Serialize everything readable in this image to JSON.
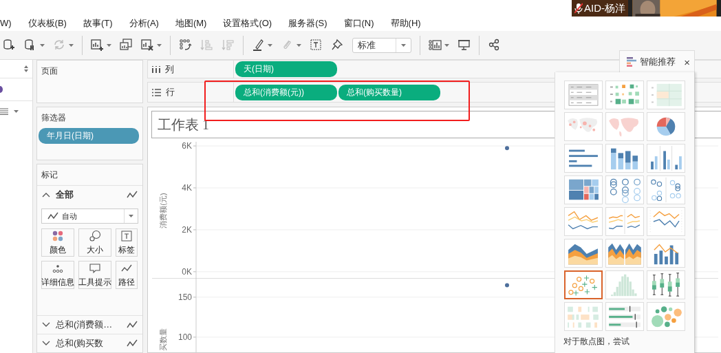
{
  "webcam": {
    "label": "AID-杨洋",
    "muted": true
  },
  "menu": [
    "W)",
    "仪表板(B)",
    "故事(T)",
    "分析(A)",
    "地图(M)",
    "设置格式(O)",
    "服务器(S)",
    "窗口(N)",
    "帮助(H)"
  ],
  "toolbar": {
    "groups": [
      [
        {
          "kind": "add-data",
          "disabled": false,
          "caret": false
        },
        {
          "kind": "pause",
          "disabled": false,
          "caret": true
        },
        {
          "kind": "refresh",
          "disabled": true,
          "caret": true
        }
      ],
      [
        {
          "kind": "new-sheet",
          "disabled": false,
          "caret": true
        },
        {
          "kind": "duplicate",
          "disabled": false,
          "caret": false
        },
        {
          "kind": "clear",
          "disabled": false,
          "caret": true
        }
      ],
      [
        {
          "kind": "swap",
          "disabled": false,
          "caret": false
        },
        {
          "kind": "sort-asc",
          "disabled": true,
          "caret": false
        },
        {
          "kind": "sort-desc",
          "disabled": true,
          "caret": false
        }
      ],
      [
        {
          "kind": "highlight",
          "disabled": false,
          "caret": true
        },
        {
          "kind": "group",
          "disabled": true,
          "caret": true
        },
        {
          "kind": "label",
          "disabled": false,
          "caret": false
        },
        {
          "kind": "pin",
          "disabled": false,
          "caret": false
        },
        {
          "kind": "dropdown",
          "value": "标准"
        }
      ],
      [
        {
          "kind": "show-cards",
          "disabled": false,
          "caret": true
        },
        {
          "kind": "present",
          "disabled": false,
          "caret": false
        }
      ],
      [
        {
          "kind": "share",
          "disabled": false,
          "caret": false
        }
      ]
    ]
  },
  "pages": {
    "title": "页面"
  },
  "filters": {
    "title": "筛选器",
    "pills": [
      "年月日(日期)"
    ]
  },
  "marks": {
    "title": "标记",
    "all": {
      "label": "全部",
      "expanded": true
    },
    "mark_type": "自动",
    "buttons": [
      {
        "label": "颜色",
        "kind": "color"
      },
      {
        "label": "大小",
        "kind": "size"
      },
      {
        "label": "标签",
        "kind": "label"
      },
      {
        "label": "详细信息",
        "kind": "detail"
      },
      {
        "label": "工具提示",
        "kind": "tooltip"
      },
      {
        "label": "路径",
        "kind": "path"
      }
    ],
    "measures": [
      {
        "label": "总和(消费额…",
        "expanded": false
      },
      {
        "label": "总和(购买数",
        "expanded": false
      }
    ]
  },
  "shelves": {
    "columns": {
      "label": "列",
      "pills": [
        "天(日期)"
      ]
    },
    "rows": {
      "label": "行",
      "pills": [
        "总和(消费额(元))",
        "总和(购买数量)"
      ]
    }
  },
  "view": {
    "title": "工作表 1",
    "panes": [
      {
        "chart_data": {
          "type": "scatter",
          "grid": true,
          "ylabel": "消费额(元)",
          "ylim": [
            -300,
            6200
          ],
          "yticks": [
            {
              "value": 0,
              "label": "0K"
            },
            {
              "value": 2000,
              "label": "2K"
            },
            {
              "value": 4000,
              "label": "4K"
            },
            {
              "value": 6000,
              "label": "6K"
            }
          ],
          "values": [
            5900
          ]
        }
      },
      {
        "chart_data": {
          "type": "scatter",
          "grid": true,
          "ylabel": "买数量",
          "ylim": [
            81,
            174
          ],
          "yticks": [
            {
              "value": 100,
              "label": "100"
            },
            {
              "value": 150,
              "label": "150"
            }
          ],
          "values": [
            165
          ]
        }
      }
    ]
  },
  "show_me": {
    "title": "智能推荐",
    "close": "×",
    "hint": "对于散点图，尝试",
    "thumbnails": [
      {
        "kind": "text-table",
        "selected": false
      },
      {
        "kind": "heat-map",
        "selected": false
      },
      {
        "kind": "highlight-table",
        "selected": false
      },
      {
        "kind": "symbol-map",
        "selected": false
      },
      {
        "kind": "filled-map",
        "selected": false
      },
      {
        "kind": "pie",
        "selected": false
      },
      {
        "kind": "hbar",
        "selected": false
      },
      {
        "kind": "stacked-bar",
        "selected": false
      },
      {
        "kind": "side-bar",
        "selected": false
      },
      {
        "kind": "treemap",
        "selected": false
      },
      {
        "kind": "circles",
        "selected": false
      },
      {
        "kind": "side-circles",
        "selected": false
      },
      {
        "kind": "lines",
        "selected": false
      },
      {
        "kind": "lines-split",
        "selected": false
      },
      {
        "kind": "dual-line",
        "selected": false
      },
      {
        "kind": "area",
        "selected": false
      },
      {
        "kind": "area-split",
        "selected": false
      },
      {
        "kind": "combo",
        "selected": false
      },
      {
        "kind": "scatter",
        "selected": true
      },
      {
        "kind": "histogram",
        "selected": false
      },
      {
        "kind": "box-plot",
        "selected": false
      },
      {
        "kind": "gantt",
        "selected": false
      },
      {
        "kind": "bullet",
        "selected": false
      },
      {
        "kind": "bubbles",
        "selected": false
      }
    ]
  }
}
